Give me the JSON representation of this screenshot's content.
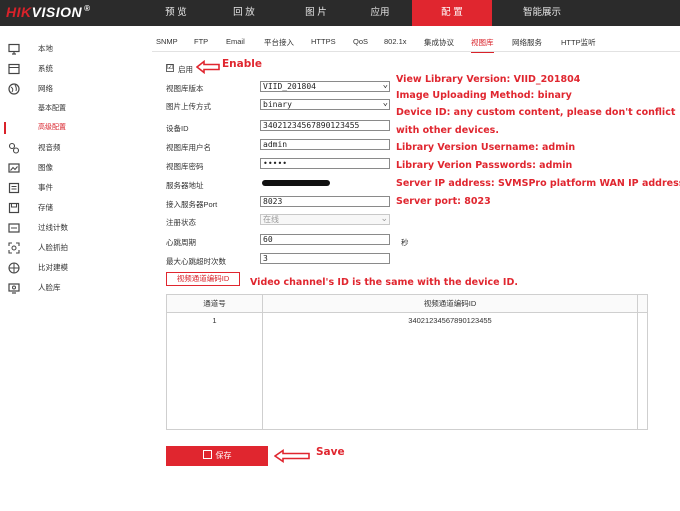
{
  "logo": {
    "part1": "HIK",
    "part2": "VISION",
    "mark": "®"
  },
  "nav": [
    "预 览",
    "回 放",
    "图 片",
    "应用",
    "配 置",
    "智能展示"
  ],
  "nav_active_index": 4,
  "sidebar": {
    "items": [
      {
        "label": "本地",
        "icon": "monitor-icon"
      },
      {
        "label": "系统",
        "icon": "system-icon"
      },
      {
        "label": "网络",
        "icon": "globe-icon"
      }
    ],
    "subitems": [
      "基本配置",
      "高级配置"
    ],
    "active_sub": "高级配置",
    "items2": [
      {
        "label": "视音频",
        "icon": "video-audio-icon"
      },
      {
        "label": "图像",
        "icon": "image-icon"
      },
      {
        "label": "事件",
        "icon": "event-icon"
      },
      {
        "label": "存储",
        "icon": "storage-icon"
      },
      {
        "label": "过线计数",
        "icon": "line-count-icon"
      },
      {
        "label": "人脸抓拍",
        "icon": "face-capture-icon"
      },
      {
        "label": "比对建模",
        "icon": "compare-icon"
      },
      {
        "label": "人脸库",
        "icon": "face-library-icon"
      }
    ]
  },
  "tabs": [
    "SNMP",
    "FTP",
    "Email",
    "平台接入",
    "HTTPS",
    "QoS",
    "802.1x",
    "集成协议",
    "视图库",
    "网络服务",
    "HTTP监听"
  ],
  "active_tab": "视图库",
  "form": {
    "enable_label": "启用",
    "enable_checked": "☑",
    "version_label": "视图库版本",
    "version_value": "VIID_201804",
    "upload_label": "图片上传方式",
    "upload_value": "binary",
    "device_id_label": "设备ID",
    "device_id_value": "34021234567890123455",
    "username_label": "视图库用户名",
    "username_value": "admin",
    "password_label": "视图库密码",
    "password_value": "•••••",
    "server_label": "服务器地址",
    "port_label": "接入服务器Port",
    "port_value": "8023",
    "reg_status_label": "注册状态",
    "reg_status_value": "在线",
    "heartbeat_label": "心跳周期",
    "heartbeat_value": "60",
    "heartbeat_unit": "秒",
    "max_timeout_label": "最大心跳超时次数",
    "max_timeout_value": "3"
  },
  "channel_button": "视频通道编码ID",
  "table": {
    "headers": [
      "通道号",
      "视频通道编码ID"
    ],
    "rows": [
      [
        "1",
        "34021234567890123455"
      ]
    ]
  },
  "save_button": "保存",
  "annotations": {
    "enable": "Enable",
    "version": "View Library Version: VIID_201804",
    "upload": "Image Uploading Method: binary",
    "device_id_1": "Device ID: any custom content, please don't conflict",
    "device_id_2": "with other devices.",
    "username": "Library Version Username: admin",
    "password": "Library Verion Passwords: admin",
    "server": "Server IP address: SVMSPro platform WAN IP address",
    "port": "Server port: 8023",
    "channel": "Video channel's ID is the same with the device ID.",
    "save": "Save"
  },
  "colors": {
    "accent": "#e0262f",
    "topbar": "#2b2b2b"
  }
}
